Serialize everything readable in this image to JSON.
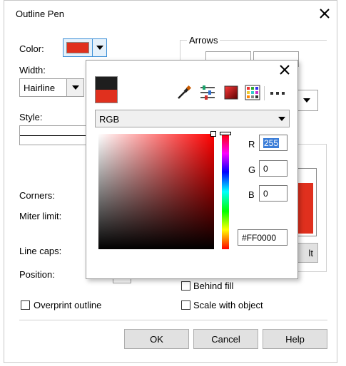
{
  "title": "Outline Pen",
  "labels": {
    "color": "Color:",
    "width": "Width:",
    "style": "Style:",
    "corners": "Corners:",
    "miter_limit": "Miter limit:",
    "line_caps": "Line caps:",
    "position": "Position:",
    "arrows": "Arrows"
  },
  "width_value": "Hairline",
  "checkboxes": {
    "behind_fill": "Behind fill",
    "scale_with_object": "Scale with object",
    "overprint_outline": "Overprint outline"
  },
  "buttons": {
    "ok": "OK",
    "cancel": "Cancel",
    "help": "Help",
    "partial": "lt"
  },
  "partial_label": ":",
  "picker": {
    "model": "RGB",
    "r_label": "R",
    "r_value": "255",
    "g_label": "G",
    "g_value": "0",
    "b_label": "B",
    "b_value": "0",
    "hex_value": "#FF0000"
  },
  "colors": {
    "current": "#e0301e",
    "old": "#1e1e1e",
    "swatch": "#e0301e",
    "preview": "#e0301e"
  },
  "icons": [
    "close-icon",
    "eyedropper-icon",
    "color-sliders-icon",
    "color-viewer-icon",
    "color-palette-icon",
    "more-icon"
  ]
}
